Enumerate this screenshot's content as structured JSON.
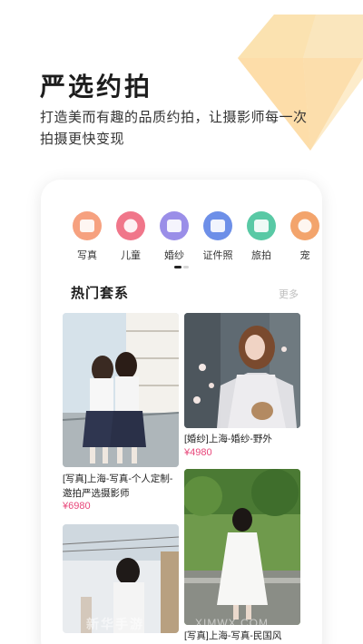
{
  "header": {
    "title": "严选约拍",
    "subtitle": "打造美而有趣的品质约拍，让摄影师每一次拍摄更快变现"
  },
  "categories": [
    {
      "label": "写真",
      "icon": "camera-icon",
      "color": "#f6a17f"
    },
    {
      "label": "儿童",
      "icon": "child-icon",
      "color": "#f0768a"
    },
    {
      "label": "婚纱",
      "icon": "wedding-dress-icon",
      "color": "#9a8ee8"
    },
    {
      "label": "证件照",
      "icon": "id-photo-icon",
      "color": "#6d8fe8"
    },
    {
      "label": "旅拍",
      "icon": "airplane-icon",
      "color": "#59c9a5"
    },
    {
      "label": "宠",
      "icon": "pet-icon",
      "color": "#f3a46c"
    }
  ],
  "section": {
    "title": "热门套系",
    "more": "更多"
  },
  "products": [
    {
      "name": "[写真]上海-写真-个人定制-邀拍严选摄影师",
      "price": "¥6980"
    },
    {
      "name": "[婚纱]上海-婚纱-野外",
      "price": "¥4980"
    },
    {
      "name": "",
      "price": ""
    },
    {
      "name": "[写真]上海-写真-民国风",
      "price": ""
    }
  ],
  "watermark": {
    "text": "新华手游",
    "url": "XIMWX.COM"
  },
  "colors": {
    "accent": "#e8467a",
    "diamond": "#fbe3b4"
  }
}
